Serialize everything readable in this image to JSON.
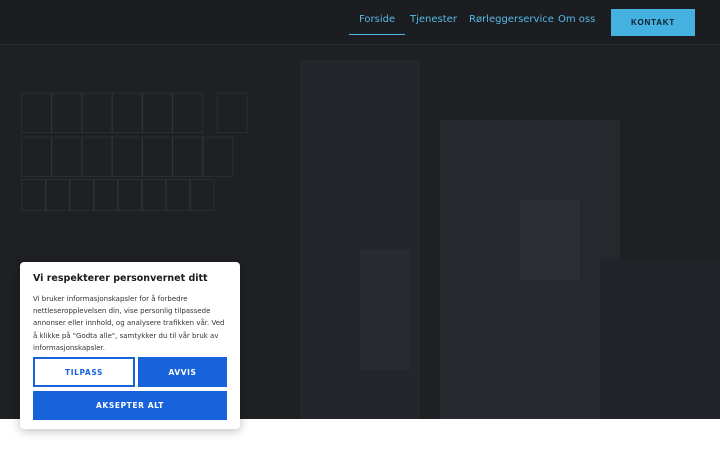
{
  "nav": {
    "items": [
      {
        "label": "Forside",
        "active": true
      },
      {
        "label": "Tjenester",
        "active": false
      },
      {
        "label": "Rørleggerservice",
        "active": false
      },
      {
        "label": "Om oss",
        "active": false
      }
    ],
    "cta_label": "KONTAKT"
  },
  "cookie": {
    "title": "Vi respekterer personvernet ditt",
    "text": "Vi bruker informasjonskapsler for å forbedre nettleseropplevelsen din, vise personlig tilpassede annonser eller innhold, og analysere trafikken vår. Ved å klikke på \"Godta alle\", samtykker du til vår bruk av informasjonskapsler.",
    "customize_label": "TILPASS",
    "reject_label": "AVVIS",
    "accept_label": "AKSEPTER ALT"
  },
  "colors": {
    "accent": "#45b1e0",
    "nav_text": "#55b9e6",
    "cookie_button": "#1863dc",
    "hero_bg": "#1e2024"
  }
}
